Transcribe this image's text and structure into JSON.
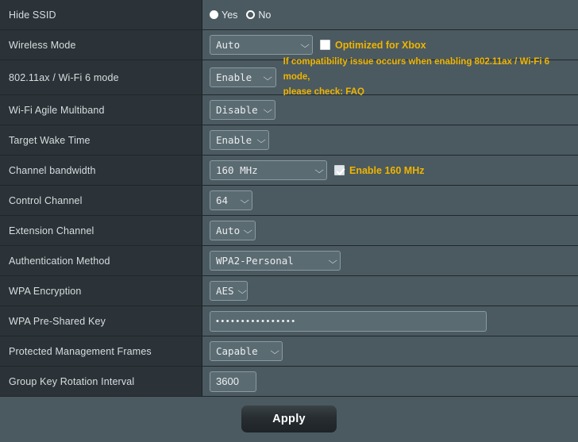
{
  "rows": [
    {
      "label": "Hide SSID",
      "type": "radio",
      "options": [
        {
          "label": "Yes",
          "selected": false
        },
        {
          "label": "No",
          "selected": true
        }
      ]
    },
    {
      "label": "Wireless Mode",
      "type": "select-checkbox",
      "select_value": "Auto",
      "checkbox_label": "Optimized for Xbox",
      "checkbox_checked": false
    },
    {
      "label": "802.11ax / Wi-Fi 6 mode",
      "type": "select-note",
      "select_value": "Enable",
      "note_line1": "If compatibility issue occurs when enabling 802.11ax / Wi-Fi 6 mode,",
      "note_line2_prefix": "please check: ",
      "note_link": "FAQ"
    },
    {
      "label": "Wi-Fi Agile Multiband",
      "type": "select",
      "select_value": "Disable"
    },
    {
      "label": "Target Wake Time",
      "type": "select",
      "select_value": "Enable"
    },
    {
      "label": "Channel bandwidth",
      "type": "select-checkbox",
      "select_value": "160 MHz",
      "checkbox_label": "Enable 160 MHz",
      "checkbox_checked": true
    },
    {
      "label": "Control Channel",
      "type": "select",
      "select_value": "64"
    },
    {
      "label": "Extension Channel",
      "type": "select",
      "select_value": "Auto"
    },
    {
      "label": "Authentication Method",
      "type": "select",
      "select_value": "WPA2-Personal"
    },
    {
      "label": "WPA Encryption",
      "type": "select",
      "select_value": "AES"
    },
    {
      "label": "WPA Pre-Shared Key",
      "type": "password",
      "value": "••••••••••••••••"
    },
    {
      "label": "Protected Management Frames",
      "type": "select",
      "select_value": "Capable"
    },
    {
      "label": "Group Key Rotation Interval",
      "type": "number",
      "value": "3600"
    }
  ],
  "footer": {
    "apply_label": "Apply"
  },
  "colors": {
    "label_bg": "#2b3338",
    "value_bg": "#4b5a60",
    "accent_yellow": "#f0b400",
    "control_bg": "#5b6b72",
    "control_border": "#8b9aa0"
  }
}
